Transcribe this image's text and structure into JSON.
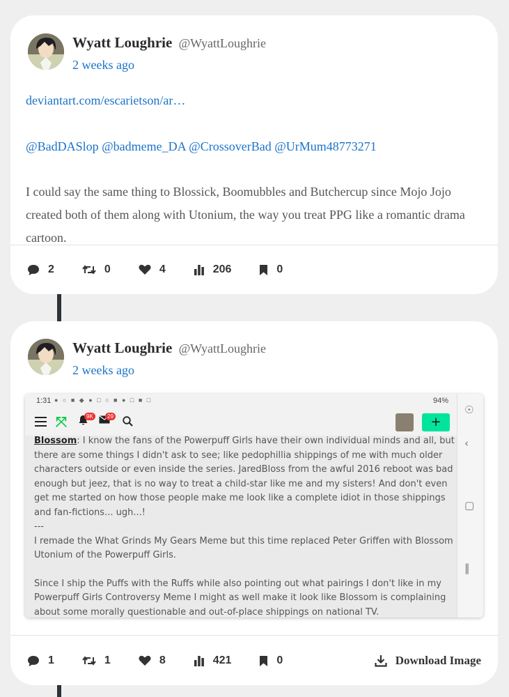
{
  "posts": [
    {
      "author": "Wyatt Loughrie",
      "handle": "@WyattLoughrie",
      "time": "2 weeks ago",
      "link": "deviantart.com/escarietson/ar…",
      "mentions": "@BadDASlop @badmeme_DA @CrossoverBad @UrMum48773271",
      "body": "I could say the same thing to Blossick, Boomubbles and Butchercup since Mojo Jojo created both of them along with Utonium, the way you treat PPG like a romantic drama cartoon.",
      "stats": {
        "comments": "2",
        "reposts": "0",
        "likes": "4",
        "views": "206",
        "bookmarks": "0"
      }
    },
    {
      "author": "Wyatt Loughrie",
      "handle": "@WyattLoughrie",
      "time": "2 weeks ago",
      "stats": {
        "comments": "1",
        "reposts": "1",
        "likes": "8",
        "views": "421",
        "bookmarks": "0"
      },
      "download_label": "Download Image",
      "screenshot": {
        "clock": "1:31",
        "battery": "94%",
        "bell_badge": "9K",
        "mail_badge": "29",
        "plus": "+",
        "speaker": "Blossom",
        "paragraph1": ": I know the fans of the Powerpuff Girls have their own individual minds and all, but there are some things I didn't ask to see; like pedophillia shippings of me with much older characters outside or even inside the series. JaredBloss from the awful 2016 reboot was bad enough but jeez, that is no way to treat a child-star like me and my sisters! And don't even get me started on how those people make me look like a complete idiot in those shippings and fan-fictions... ugh...!",
        "separator": "---",
        "paragraph2": "I remade the What Grinds My Gears Meme but this time replaced Peter Griffen with Blossom Utonium of the Powerpuff Girls.",
        "paragraph3": "Since I ship the Puffs with the Ruffs while also pointing out what pairings I don't like in my Powerpuff Girls Controversy Meme I might as well make it look like Blossom is complaining about some morally questionable and out-of-place shippings on national TV."
      }
    }
  ]
}
